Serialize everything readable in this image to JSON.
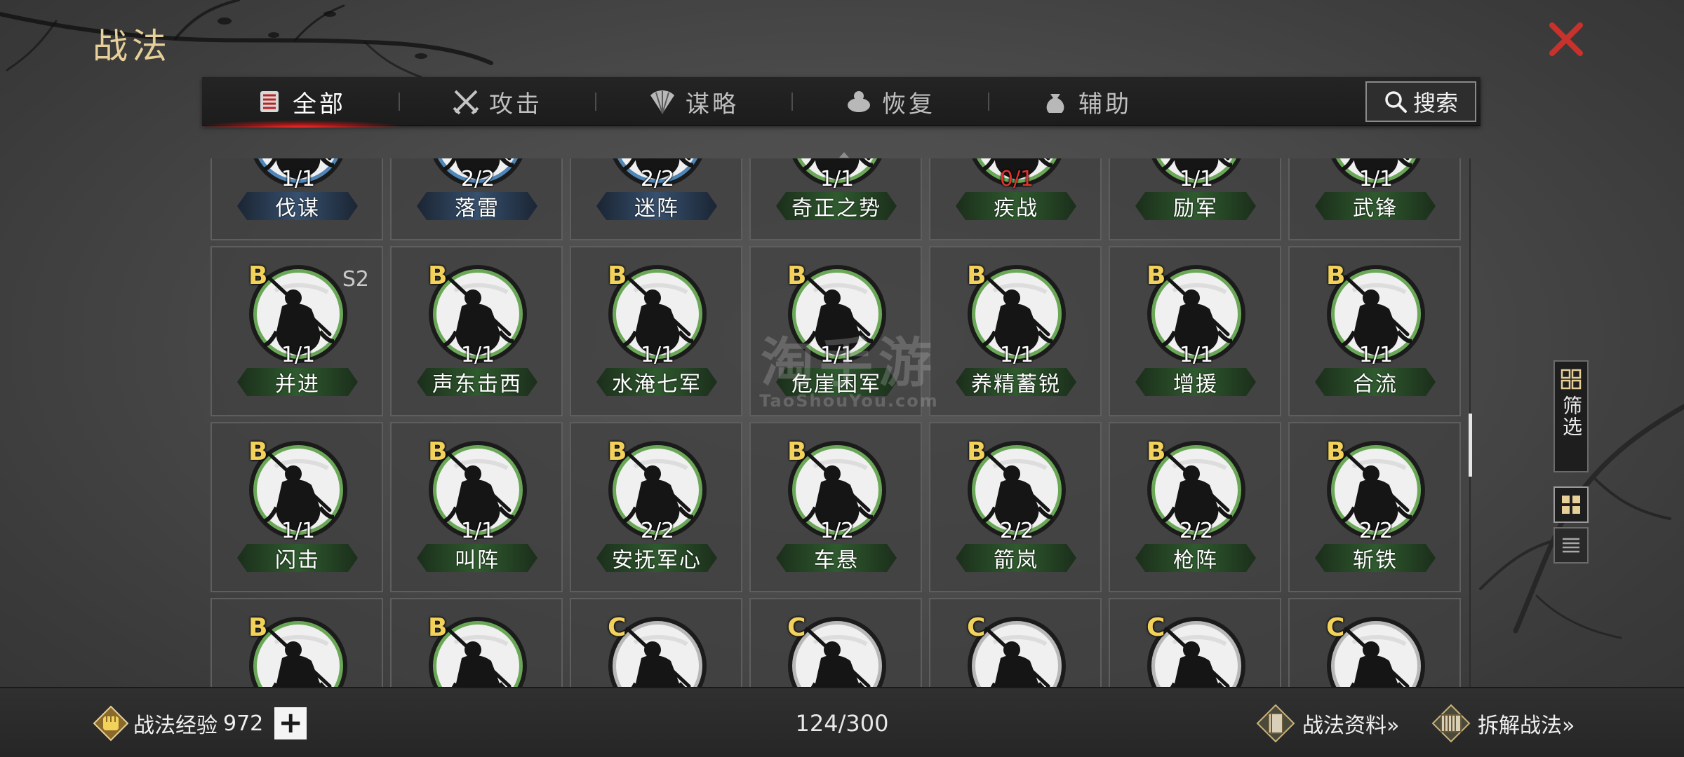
{
  "header": {
    "title": "战法",
    "close_icon": "close-icon"
  },
  "tabs": [
    {
      "label": "全部",
      "icon": "all-scrolls-icon",
      "active": true
    },
    {
      "label": "攻击",
      "icon": "crossed-swords-icon",
      "active": false
    },
    {
      "label": "谋略",
      "icon": "fan-icon",
      "active": false
    },
    {
      "label": "恢复",
      "icon": "recovery-icon",
      "active": false
    },
    {
      "label": "辅助",
      "icon": "bag-icon",
      "active": false
    }
  ],
  "search": {
    "label": "搜索",
    "icon": "search-icon"
  },
  "skills": [
    {
      "name": "伐谋",
      "level": "1/1",
      "grade": "",
      "season": "",
      "plate": "blue",
      "ring": "blue"
    },
    {
      "name": "落雷",
      "level": "2/2",
      "grade": "",
      "season": "",
      "plate": "blue",
      "ring": "blue"
    },
    {
      "name": "迷阵",
      "level": "2/2",
      "grade": "",
      "season": "",
      "plate": "blue",
      "ring": "blue"
    },
    {
      "name": "奇正之势",
      "level": "1/1",
      "grade": "",
      "season": "",
      "plate": "green",
      "ring": "green"
    },
    {
      "name": "疾战",
      "level": "0/1",
      "grade": "",
      "season": "",
      "plate": "green",
      "ring": "green",
      "warn": true
    },
    {
      "name": "励军",
      "level": "1/1",
      "grade": "",
      "season": "",
      "plate": "green",
      "ring": "green"
    },
    {
      "name": "武锋",
      "level": "1/1",
      "grade": "",
      "season": "",
      "plate": "green",
      "ring": "green"
    },
    {
      "name": "并进",
      "level": "1/1",
      "grade": "B",
      "season": "S2",
      "plate": "green",
      "ring": "green"
    },
    {
      "name": "声东击西",
      "level": "1/1",
      "grade": "B",
      "season": "",
      "plate": "green",
      "ring": "green"
    },
    {
      "name": "水淹七军",
      "level": "1/1",
      "grade": "B",
      "season": "",
      "plate": "green",
      "ring": "green"
    },
    {
      "name": "危崖困军",
      "level": "1/1",
      "grade": "B",
      "season": "",
      "plate": "green",
      "ring": "green"
    },
    {
      "name": "养精蓄锐",
      "level": "1/1",
      "grade": "B",
      "season": "",
      "plate": "green",
      "ring": "green"
    },
    {
      "name": "增援",
      "level": "1/1",
      "grade": "B",
      "season": "",
      "plate": "green",
      "ring": "green"
    },
    {
      "name": "合流",
      "level": "1/1",
      "grade": "B",
      "season": "",
      "plate": "green",
      "ring": "green"
    },
    {
      "name": "闪击",
      "level": "1/1",
      "grade": "B",
      "season": "",
      "plate": "green",
      "ring": "green"
    },
    {
      "name": "叫阵",
      "level": "1/1",
      "grade": "B",
      "season": "",
      "plate": "green",
      "ring": "green"
    },
    {
      "name": "安抚军心",
      "level": "2/2",
      "grade": "B",
      "season": "",
      "plate": "green",
      "ring": "green"
    },
    {
      "name": "车悬",
      "level": "1/2",
      "grade": "B",
      "season": "",
      "plate": "green",
      "ring": "green"
    },
    {
      "name": "箭岚",
      "level": "2/2",
      "grade": "B",
      "season": "",
      "plate": "green",
      "ring": "green"
    },
    {
      "name": "枪阵",
      "level": "2/2",
      "grade": "B",
      "season": "",
      "plate": "green",
      "ring": "green"
    },
    {
      "name": "斩铁",
      "level": "2/2",
      "grade": "B",
      "season": "",
      "plate": "green",
      "ring": "green"
    },
    {
      "name": "",
      "level": "",
      "grade": "B",
      "season": "",
      "plate": "green",
      "ring": "green"
    },
    {
      "name": "",
      "level": "",
      "grade": "B",
      "season": "",
      "plate": "green",
      "ring": "green"
    },
    {
      "name": "",
      "level": "",
      "grade": "C",
      "season": "",
      "plate": "gray",
      "ring": "gray"
    },
    {
      "name": "",
      "level": "",
      "grade": "C",
      "season": "",
      "plate": "gray",
      "ring": "gray"
    },
    {
      "name": "",
      "level": "",
      "grade": "C",
      "season": "",
      "plate": "gray",
      "ring": "gray"
    },
    {
      "name": "",
      "level": "",
      "grade": "C",
      "season": "",
      "plate": "gray",
      "ring": "gray"
    },
    {
      "name": "",
      "level": "",
      "grade": "C",
      "season": "",
      "plate": "gray",
      "ring": "gray"
    }
  ],
  "watermark": {
    "main": "淘手游",
    "sub": "TaoShouYou.com"
  },
  "side_tools": {
    "filter_label": "筛选",
    "filter_icon": "filter-icon",
    "grid_icon": "grid-view-icon",
    "list_icon": "list-view-icon"
  },
  "footer": {
    "exp_label": "战法经验",
    "exp_value": "972",
    "plus_label": "+",
    "count": "124/300",
    "info_link": "战法资料»",
    "disassemble_link": "拆解战法»"
  },
  "colors": {
    "title": "#e6cf98",
    "close": "#c8322c",
    "grade": "#f2d25a",
    "ring_green": "#6aa857",
    "ring_blue": "#4f86b8",
    "ring_gray": "#b8b8b8",
    "tab_active_glow": "#ff2a2a",
    "level_warn": "#e0332d"
  }
}
